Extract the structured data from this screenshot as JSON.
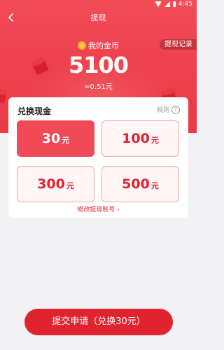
{
  "status_bar": {
    "time": "4:45"
  },
  "nav": {
    "title": "提现"
  },
  "coins": {
    "label": "我的金币",
    "value": "5100",
    "rmb": "≈0.51元"
  },
  "record_button": "提现记录",
  "card": {
    "title": "兑换现金",
    "rules_label": "规则",
    "options": [
      {
        "amount": "30",
        "unit": "元",
        "selected": true
      },
      {
        "amount": "100",
        "unit": "元",
        "selected": false
      },
      {
        "amount": "300",
        "unit": "元",
        "selected": false
      },
      {
        "amount": "500",
        "unit": "元",
        "selected": false
      }
    ],
    "change_account": "修改提现账号 ›"
  },
  "submit_button": "提交申请（兑换30元）",
  "colors": {
    "brand_red": "#e1222f",
    "header_red": "#ef4a55"
  }
}
